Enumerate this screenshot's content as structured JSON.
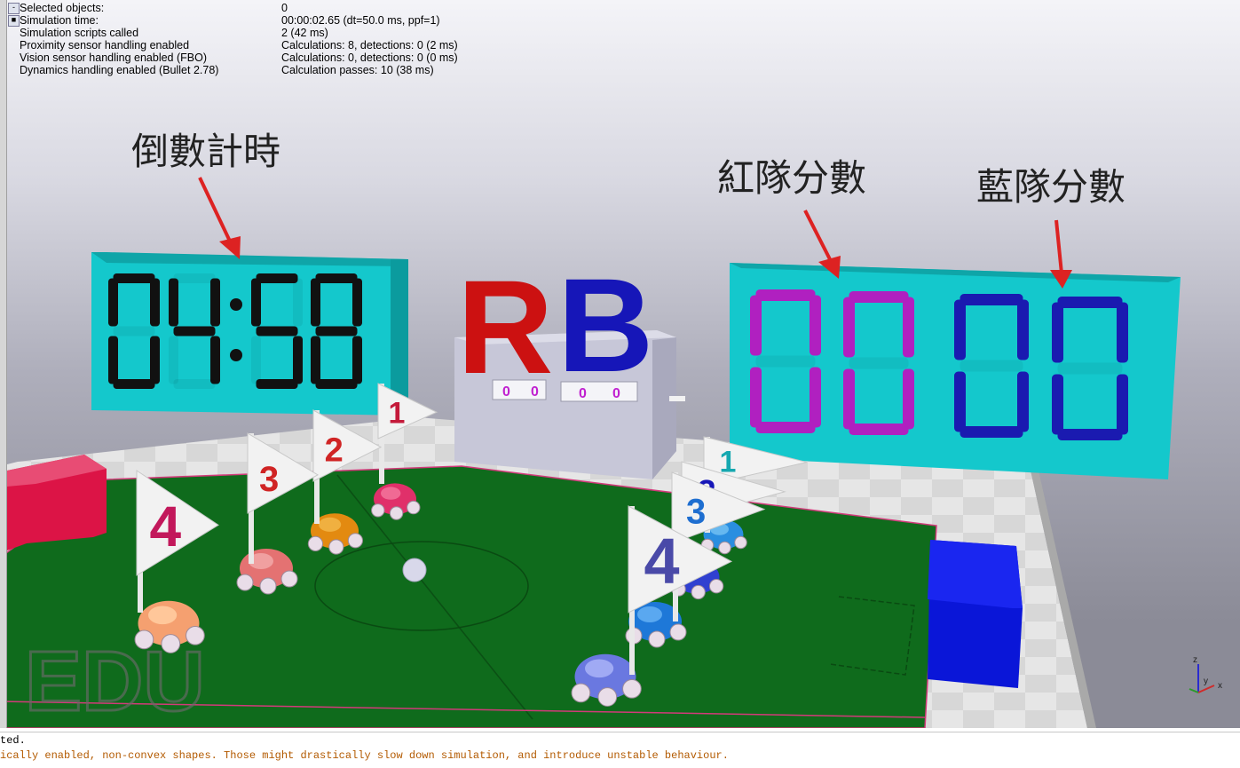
{
  "info": {
    "rows": [
      {
        "toggle": "-",
        "key": "Selected objects:",
        "value": "0"
      },
      {
        "toggle": "■",
        "key": "Simulation time:",
        "value": "00:00:02.65 (dt=50.0 ms, ppf=1)"
      },
      {
        "toggle": "",
        "key": "Simulation scripts called",
        "value": "2 (42 ms)"
      },
      {
        "toggle": "",
        "key": "Proximity sensor handling enabled",
        "value": "Calculations: 8, detections: 0 (2 ms)"
      },
      {
        "toggle": "",
        "key": "Vision sensor handling enabled (FBO)",
        "value": "Calculations: 0, detections: 0 (0 ms)"
      },
      {
        "toggle": "",
        "key": "Dynamics handling enabled (Bullet 2.78)",
        "value": "Calculation passes: 10 (38 ms)"
      }
    ]
  },
  "scene": {
    "annotations": {
      "countdown": "倒數計時",
      "red_score": "紅隊分數",
      "blue_score": "藍隊分數"
    },
    "timer_display": {
      "minutes": "04",
      "seconds": "58"
    },
    "score_display": {
      "red": "00",
      "blue": "00"
    },
    "letters": {
      "red": "R",
      "blue": "B"
    },
    "mini_counters": [
      "0",
      "0",
      "0",
      "0"
    ],
    "red_flags": [
      "1",
      "2",
      "3",
      "4"
    ],
    "blue_flags": [
      "1",
      "2",
      "3",
      "4"
    ],
    "watermark": "EDU",
    "axis_labels": {
      "z": "z",
      "x": "x",
      "y": "y"
    },
    "colors": {
      "board": "#14c8cc",
      "digit_dark": "#111111",
      "digit_magenta": "#b020c0",
      "digit_blue": "#1a1ab0",
      "red_letter": "#cc1111",
      "blue_letter": "#1616b8",
      "field": "#0f6b1c",
      "red_team": "#d93a3a",
      "blue_team": "#2f4fd6"
    }
  },
  "console": {
    "line1": "ted.",
    "line2": "ically enabled, non-convex shapes. Those might drastically slow down simulation, and introduce unstable behaviour."
  }
}
